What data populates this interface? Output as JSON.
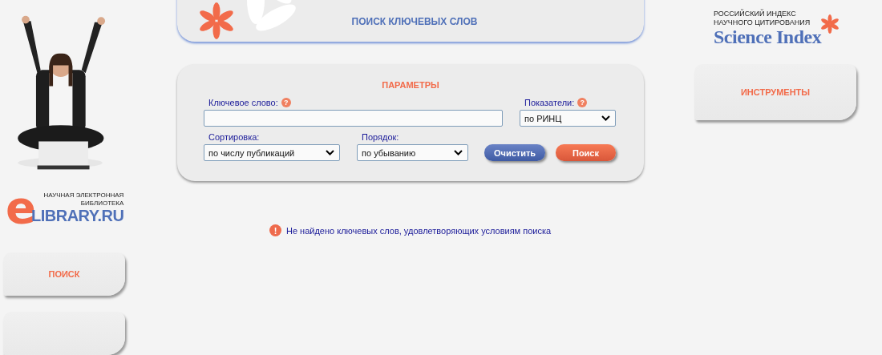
{
  "left": {
    "logo": {
      "line_1": "НАУЧНАЯ ЭЛЕКТРОННАЯ",
      "line_2": "БИБЛИОТЕКА",
      "mark": "e",
      "wordmark": "LIBRARY.RU"
    },
    "menu": [
      {
        "label": "ПОИСК"
      }
    ]
  },
  "header": {
    "title": "ПОИСК КЛЮЧЕВЫХ СЛОВ"
  },
  "parameters": {
    "title": "ПАРАМЕТРЫ",
    "keyword": {
      "label": "Ключевое слово:",
      "help": "?"
    },
    "indicators": {
      "label": "Показатели:",
      "help": "?",
      "value": "по РИНЦ"
    },
    "sorting": {
      "label": "Сортировка:",
      "value": "по числу публикаций"
    },
    "order": {
      "label": "Порядок:",
      "value": "по убыванию"
    },
    "buttons": [
      {
        "label": "Очистить",
        "kind": "secondary"
      },
      {
        "label": "Поиск",
        "kind": "primary"
      }
    ]
  },
  "message": {
    "icon": "!",
    "text": "Не найдено ключевых слов, удовлетворяющих условиям поиска"
  },
  "right": {
    "logo": {
      "line_1": "РОССИЙСКИЙ ИНДЕКС",
      "line_2": "НАУЧНОГО ЦИТИРОВАНИЯ",
      "wordmark": "Science Index"
    },
    "menu": [
      {
        "label": "ИНСТРУМЕНТЫ"
      }
    ]
  }
}
